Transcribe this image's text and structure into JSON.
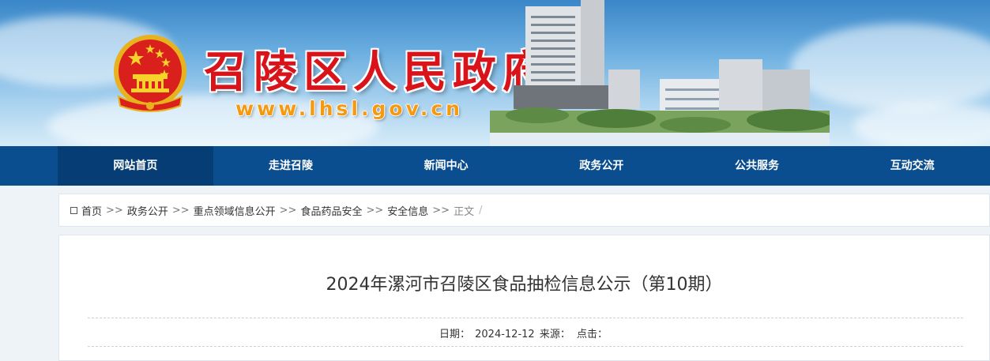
{
  "header": {
    "site_title": "召陵区人民政府",
    "site_url": "www.lhsl.gov.cn"
  },
  "nav": {
    "items": [
      "网站首页",
      "走进召陵",
      "新闻中心",
      "政务公开",
      "公共服务",
      "互动交流"
    ],
    "active_index": 0
  },
  "breadcrumb": {
    "items": [
      "首页",
      "政务公开",
      "重点领域信息公开",
      "食品药品安全",
      "安全信息"
    ],
    "separator": ">>",
    "current": "正文",
    "trailing": "/"
  },
  "article": {
    "title": "2024年漯河市召陵区食品抽检信息公示（第10期）",
    "date_label": "日期：",
    "date": "2024-12-12",
    "source_label": "来源：",
    "source": "",
    "clicks_label": "点击：",
    "clicks": ""
  },
  "colors": {
    "nav_bg": "#0b4e8f",
    "nav_active_bg": "#063d74",
    "title_red": "#d8141a",
    "url_orange": "#f49a12"
  }
}
